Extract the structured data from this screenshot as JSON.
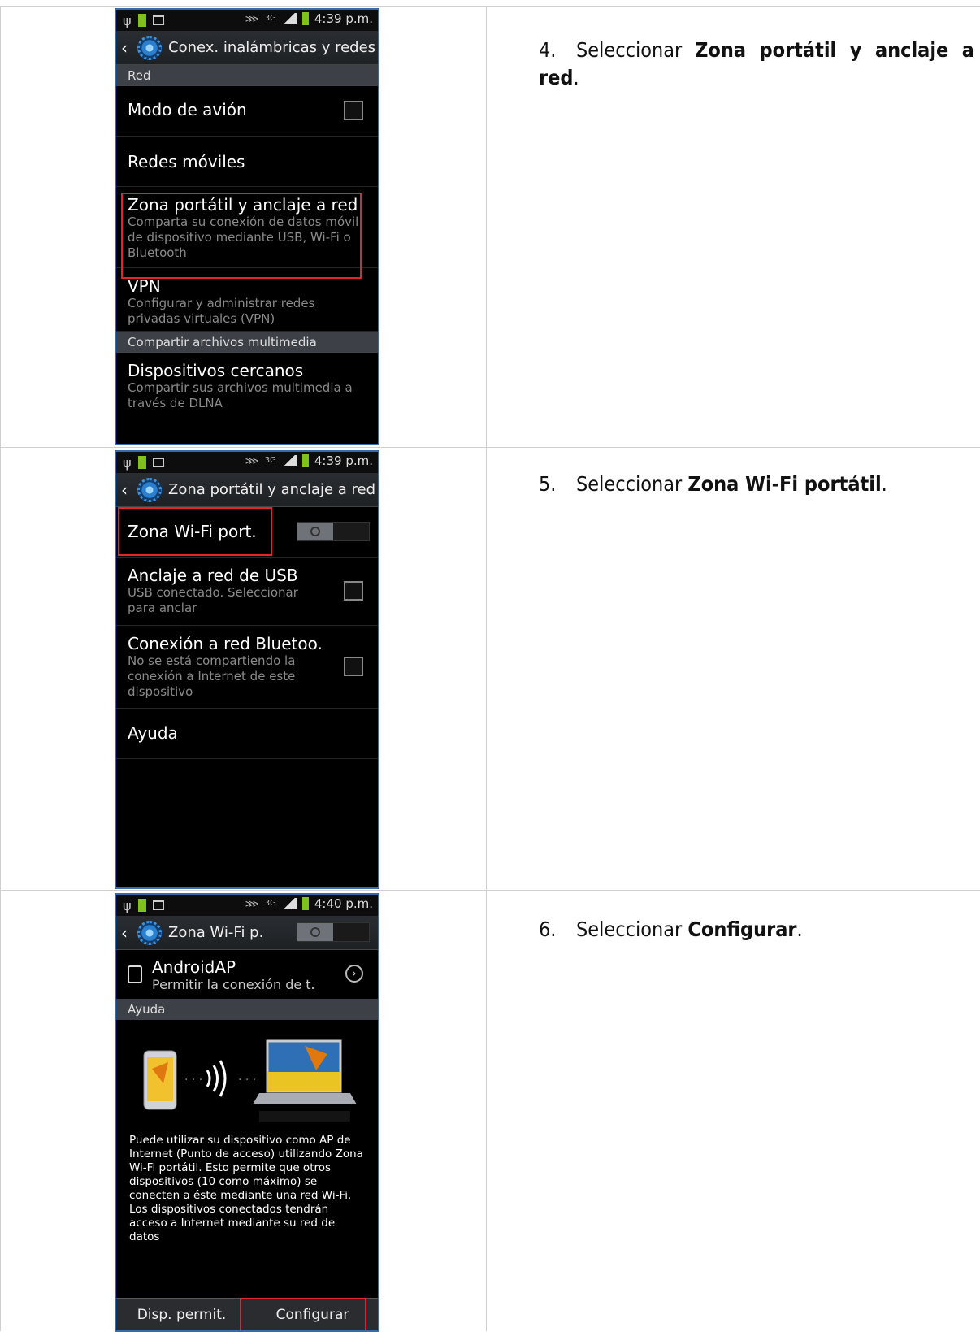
{
  "steps": [
    {
      "number": "4.",
      "text_plain": "Seleccionar ",
      "text_bold": "Zona portátil y anclaje a red",
      "text_end": "."
    },
    {
      "number": "5.",
      "text_plain": "Seleccionar ",
      "text_bold": "Zona Wi-Fi portátil",
      "text_end": "."
    },
    {
      "number": "6.",
      "text_plain": "Seleccionar ",
      "text_bold": "Configurar",
      "text_end": "."
    }
  ],
  "screen1": {
    "status_time": "4:39 p.m.",
    "status_network": "3G",
    "title": "Conex. inalámbricas y redes",
    "section_red": "Red",
    "items": [
      {
        "title": "Modo de avión",
        "subtitle": ""
      },
      {
        "title": "Redes móviles",
        "subtitle": ""
      },
      {
        "title": "Zona portátil y anclaje a red",
        "subtitle": "Comparta su conexión de datos móvil de dispositivo mediante USB, Wi-Fi o Bluetooth"
      },
      {
        "title": "VPN",
        "subtitle": "Configurar y administrar redes privadas virtuales (VPN)"
      }
    ],
    "section_media": "Compartir archivos multimedia",
    "media_item": {
      "title": "Dispositivos cercanos",
      "subtitle": "Compartir sus archivos multimedia a través de DLNA"
    }
  },
  "screen2": {
    "status_time": "4:39 p.m.",
    "status_network": "3G",
    "title": "Zona portátil y anclaje a red",
    "wifi_zone": "Zona Wi-Fi port.",
    "toggle_on": false,
    "items": [
      {
        "title": "Anclaje a red de USB",
        "subtitle": "USB conectado. Seleccionar para anclar"
      },
      {
        "title": "Conexión a red Bluetoo.",
        "subtitle": "No se está compartiendo la conexión a Internet de este dispositivo"
      },
      {
        "title": "Ayuda",
        "subtitle": ""
      }
    ]
  },
  "screen3": {
    "status_time": "4:40 p.m.",
    "status_network": "3G",
    "title": "Zona Wi-Fi p.",
    "toggle_on": false,
    "ap_name": "AndroidAP",
    "ap_sub": "Permitir la conexión de t.",
    "section_help": "Ayuda",
    "help_text": "Puede utilizar su dispositivo como AP de Internet (Punto de acceso) utilizando Zona Wi-Fi portátil. Esto permite que otros dispositivos (10 como máximo) se conecten a éste mediante una red Wi-Fi. Los dispositivos conectados tendrán acceso a Internet mediante su red de datos",
    "btn_left": "Disp. permit.",
    "btn_right": "Configurar"
  },
  "colors": {
    "highlight": "#e0252b",
    "frame": "#3c6aa8",
    "battery": "#7ec21a"
  }
}
